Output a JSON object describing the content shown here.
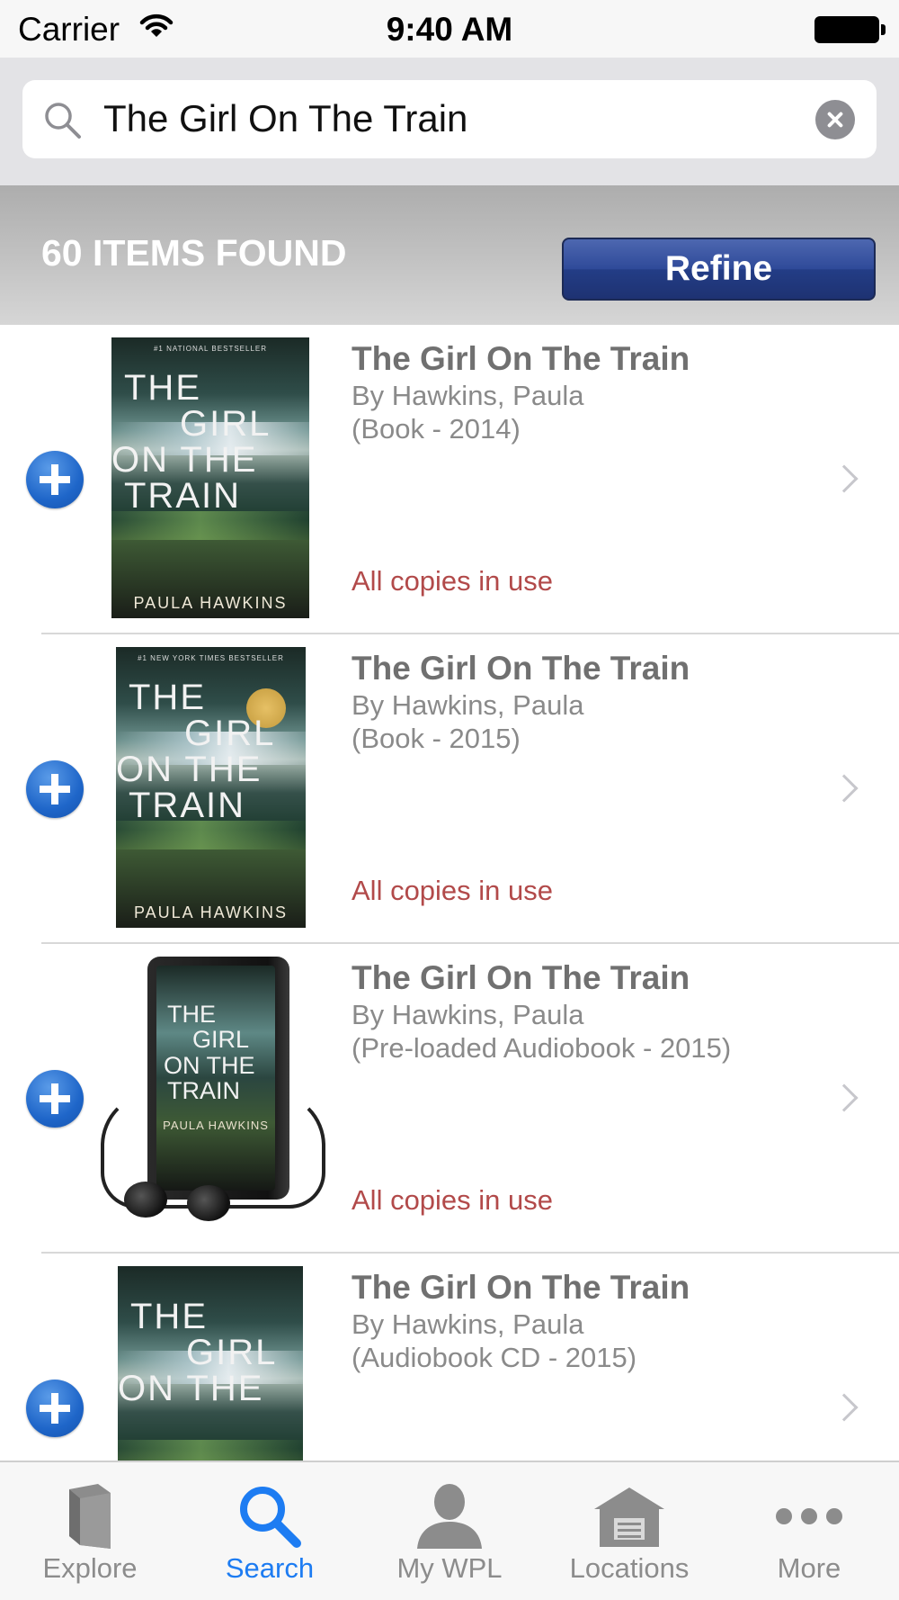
{
  "status_bar": {
    "carrier": "Carrier",
    "time": "9:40 AM"
  },
  "search": {
    "query": "The Girl On The Train"
  },
  "results_header": {
    "count_label": "60 ITEMS FOUND",
    "refine_label": "Refine"
  },
  "results": [
    {
      "title": "The Girl On The Train",
      "author": "By Hawkins, Paula",
      "format": "(Book - 2014)",
      "status": "All copies in use",
      "cover": {
        "top": "#1 NATIONAL BESTSELLER",
        "l1": "THE",
        "l2": "GIRL",
        "l3": "ON THE",
        "l4": "TRAIN",
        "author": "PAULA HAWKINS"
      }
    },
    {
      "title": "The Girl On The Train",
      "author": "By Hawkins, Paula",
      "format": "(Book - 2015)",
      "status": "All copies in use",
      "cover": {
        "top": "#1 NEW YORK TIMES BESTSELLER",
        "l1": "THE",
        "l2": "GIRL",
        "l3": "ON THE",
        "l4": "TRAIN",
        "author": "PAULA HAWKINS"
      }
    },
    {
      "title": "The Girl On The Train",
      "author": "By Hawkins, Paula",
      "format": "(Pre-loaded Audiobook - 2015)",
      "status": "All copies in use",
      "cover": {
        "l1": "THE",
        "l2": "GIRL",
        "l3": "ON THE",
        "l4": "TRAIN",
        "author": "PAULA HAWKINS"
      }
    },
    {
      "title": "The Girl On The Train",
      "author": "By Hawkins, Paula",
      "format": "(Audiobook CD - 2015)",
      "cover": {
        "l1": "THE",
        "l2": "GIRL",
        "l3": "ON THE"
      }
    }
  ],
  "tabs": [
    {
      "label": "Explore",
      "icon": "book-icon"
    },
    {
      "label": "Search",
      "icon": "search-icon",
      "active": true
    },
    {
      "label": "My WPL",
      "icon": "person-icon"
    },
    {
      "label": "Locations",
      "icon": "building-icon"
    },
    {
      "label": "More",
      "icon": "more-icon"
    }
  ],
  "colors": {
    "accent": "#1d7cf2",
    "refine_button": "#2f4a99",
    "status_text": "#b24a4a",
    "add_button": "#1f66c9"
  }
}
